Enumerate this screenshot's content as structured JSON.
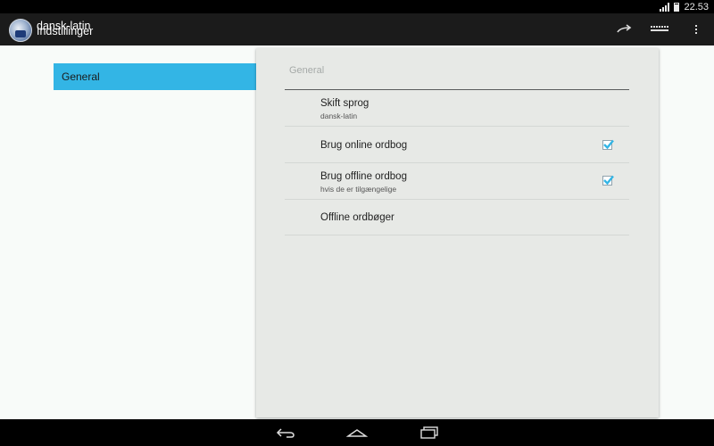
{
  "status_bar": {
    "time": "22.53",
    "icons": [
      "signal-icon",
      "battery-icon"
    ]
  },
  "action_bar": {
    "title": "dansk-latin",
    "subtitle": "Indstillinger",
    "icons": [
      "app-logo",
      "share-icon",
      "keyboard-icon",
      "overflow-menu-icon"
    ]
  },
  "headers": [
    {
      "label": "General",
      "selected": true
    }
  ],
  "panel": {
    "category": "General",
    "preferences": [
      {
        "title": "Skift sprog",
        "summary": "dansk-latin",
        "checkbox": null
      },
      {
        "title": "Brug online ordbog",
        "summary": "",
        "checkbox": true
      },
      {
        "title": "Brug offline ordbog",
        "summary": "hvis de er tilgængelige",
        "checkbox": true
      },
      {
        "title": "Offline ordbøger",
        "summary": "",
        "checkbox": null
      }
    ]
  },
  "nav_bar": {
    "icons": [
      "back-icon",
      "home-icon",
      "recent-apps-icon"
    ]
  },
  "colors": {
    "accent": "#33b5e5",
    "action_bar": "#1b1b1b",
    "panel": "#e7e9e6",
    "background": "#f8fbf9"
  }
}
